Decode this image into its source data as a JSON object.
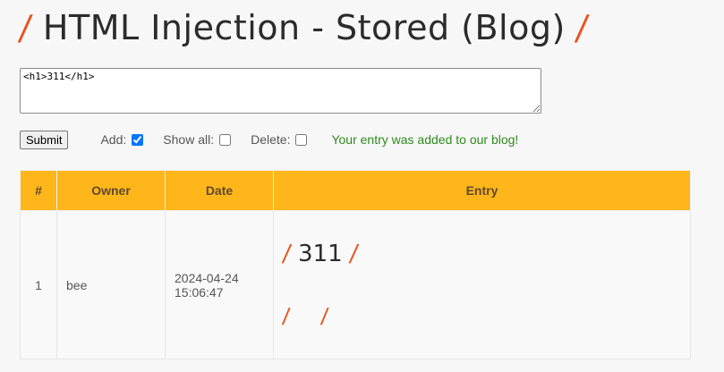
{
  "page": {
    "title": "HTML Injection - Stored (Blog)",
    "slash": "/"
  },
  "form": {
    "textarea_value": "<h1>311</h1>",
    "submit_label": "Submit",
    "add_label": "Add:",
    "add_checked": true,
    "show_all_label": "Show all:",
    "show_all_checked": false,
    "delete_label": "Delete:",
    "delete_checked": false,
    "message": "Your entry was added to our blog!"
  },
  "table": {
    "headers": [
      "#",
      "Owner",
      "Date",
      "Entry"
    ],
    "rows": [
      {
        "num": "1",
        "owner": "bee",
        "date_line1": "2024-04-24",
        "date_line2": "15:06:47",
        "entry_heading": "311"
      }
    ]
  },
  "colors": {
    "accent_slash": "#e8521f",
    "header_bg": "#ffb61a",
    "success_text": "#2f8a1e"
  }
}
